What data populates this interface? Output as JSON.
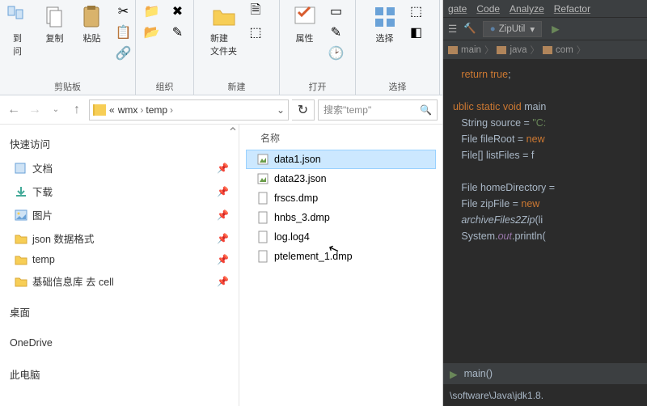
{
  "ribbon": {
    "clipboard": {
      "label": "剪贴板",
      "pin": "到\n问",
      "copy": "复制",
      "paste": "粘贴"
    },
    "organize": {
      "label": "组织"
    },
    "new": {
      "label": "新建",
      "newfolder": "新建\n文件夹"
    },
    "open": {
      "label": "打开",
      "properties": "属性"
    },
    "select": {
      "label": "选择",
      "select_btn": "选择"
    }
  },
  "address": {
    "crumbs": [
      "wmx",
      "temp"
    ],
    "prefix": "«",
    "search_placeholder": "搜索\"temp\""
  },
  "sidebar": {
    "quick_access": "快速访问",
    "items": [
      {
        "label": "文档",
        "kind": "doc",
        "pin": true
      },
      {
        "label": "下载",
        "kind": "dl",
        "pin": true
      },
      {
        "label": "图片",
        "kind": "pic",
        "pin": true
      },
      {
        "label": "json 数据格式",
        "kind": "folder",
        "pin": true
      },
      {
        "label": "temp",
        "kind": "folder",
        "pin": true
      },
      {
        "label": "基础信息库 去 cell",
        "kind": "folder",
        "pin": true
      }
    ],
    "desktop": "桌面",
    "onedrive": "OneDrive",
    "thispc": "此电脑"
  },
  "files": {
    "col_name": "名称",
    "rows": [
      {
        "name": "data1.json",
        "kind": "json",
        "selected": true
      },
      {
        "name": "data23.json",
        "kind": "json"
      },
      {
        "name": "frscs.dmp",
        "kind": "file"
      },
      {
        "name": "hnbs_3.dmp",
        "kind": "file"
      },
      {
        "name": "log.log4",
        "kind": "file"
      },
      {
        "name": "ptelement_1.dmp",
        "kind": "file"
      }
    ]
  },
  "ide": {
    "menu": [
      "gate",
      "Code",
      "Analyze",
      "Refactor"
    ],
    "run_config": "ZipUtil",
    "crumbs": [
      "main",
      "java",
      "com"
    ],
    "run_tab": "main()",
    "output": "\\software\\Java\\jdk1.8.",
    "code_lines": [
      {
        "t": "   ",
        "spans": [
          {
            "c": "kw",
            "t": "return true"
          },
          {
            "c": "",
            "t": ";"
          }
        ]
      },
      {
        "t": "",
        "spans": []
      },
      {
        "t": "",
        "spans": [
          {
            "c": "kw",
            "t": "ublic static void "
          },
          {
            "c": "type",
            "t": "main"
          }
        ]
      },
      {
        "t": "   ",
        "spans": [
          {
            "c": "type",
            "t": "String source = "
          },
          {
            "c": "str",
            "t": "\"C:"
          }
        ]
      },
      {
        "t": "   ",
        "spans": [
          {
            "c": "type",
            "t": "File fileRoot = "
          },
          {
            "c": "kw",
            "t": "new"
          }
        ]
      },
      {
        "t": "   ",
        "spans": [
          {
            "c": "type",
            "t": "File[] listFiles ="
          },
          {
            "c": "",
            "t": " f"
          }
        ]
      },
      {
        "t": "",
        "spans": []
      },
      {
        "t": "   ",
        "spans": [
          {
            "c": "type",
            "t": "File homeDirectory"
          },
          {
            "c": "",
            "t": " ="
          }
        ]
      },
      {
        "t": "   ",
        "spans": [
          {
            "c": "type",
            "t": "File zipFile = "
          },
          {
            "c": "kw",
            "t": "new "
          }
        ]
      },
      {
        "t": "   ",
        "spans": [
          {
            "c": "ital",
            "t": "archiveFiles2Zip"
          },
          {
            "c": "",
            "t": "(li"
          }
        ]
      },
      {
        "t": "   ",
        "spans": [
          {
            "c": "type",
            "t": "System."
          },
          {
            "c": "static",
            "t": "out"
          },
          {
            "c": "type",
            "t": ".println("
          }
        ]
      }
    ]
  }
}
